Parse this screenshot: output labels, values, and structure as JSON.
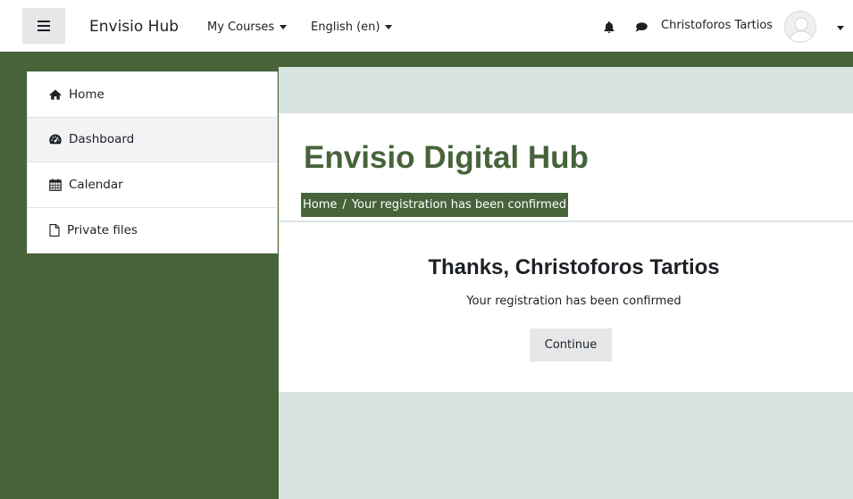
{
  "navbar": {
    "brand": "Envisio Hub",
    "my_courses": "My Courses",
    "language": "English (en)",
    "user_name": "Christoforos Tartios",
    "icons": {
      "menu": "hamburger-icon",
      "notifications": "bell-icon",
      "messages": "chat-icon"
    }
  },
  "sidebar": {
    "items": [
      {
        "label": "Home",
        "icon": "home-icon"
      },
      {
        "label": "Dashboard",
        "icon": "dashboard-icon"
      },
      {
        "label": "Calendar",
        "icon": "calendar-icon"
      },
      {
        "label": "Private files",
        "icon": "file-icon"
      }
    ]
  },
  "header": {
    "site_title": "Envisio Digital Hub",
    "breadcrumb": {
      "home": "Home",
      "separator": "/",
      "current": "Your registration has been confirmed"
    }
  },
  "main": {
    "heading": "Thanks, Christoforos Tartios",
    "message": "Your registration has been confirmed",
    "continue_label": "Continue"
  },
  "colors": {
    "brand_green": "#46633a",
    "page_bg": "#d8e4e1",
    "button_bg": "#e5e7e9"
  }
}
